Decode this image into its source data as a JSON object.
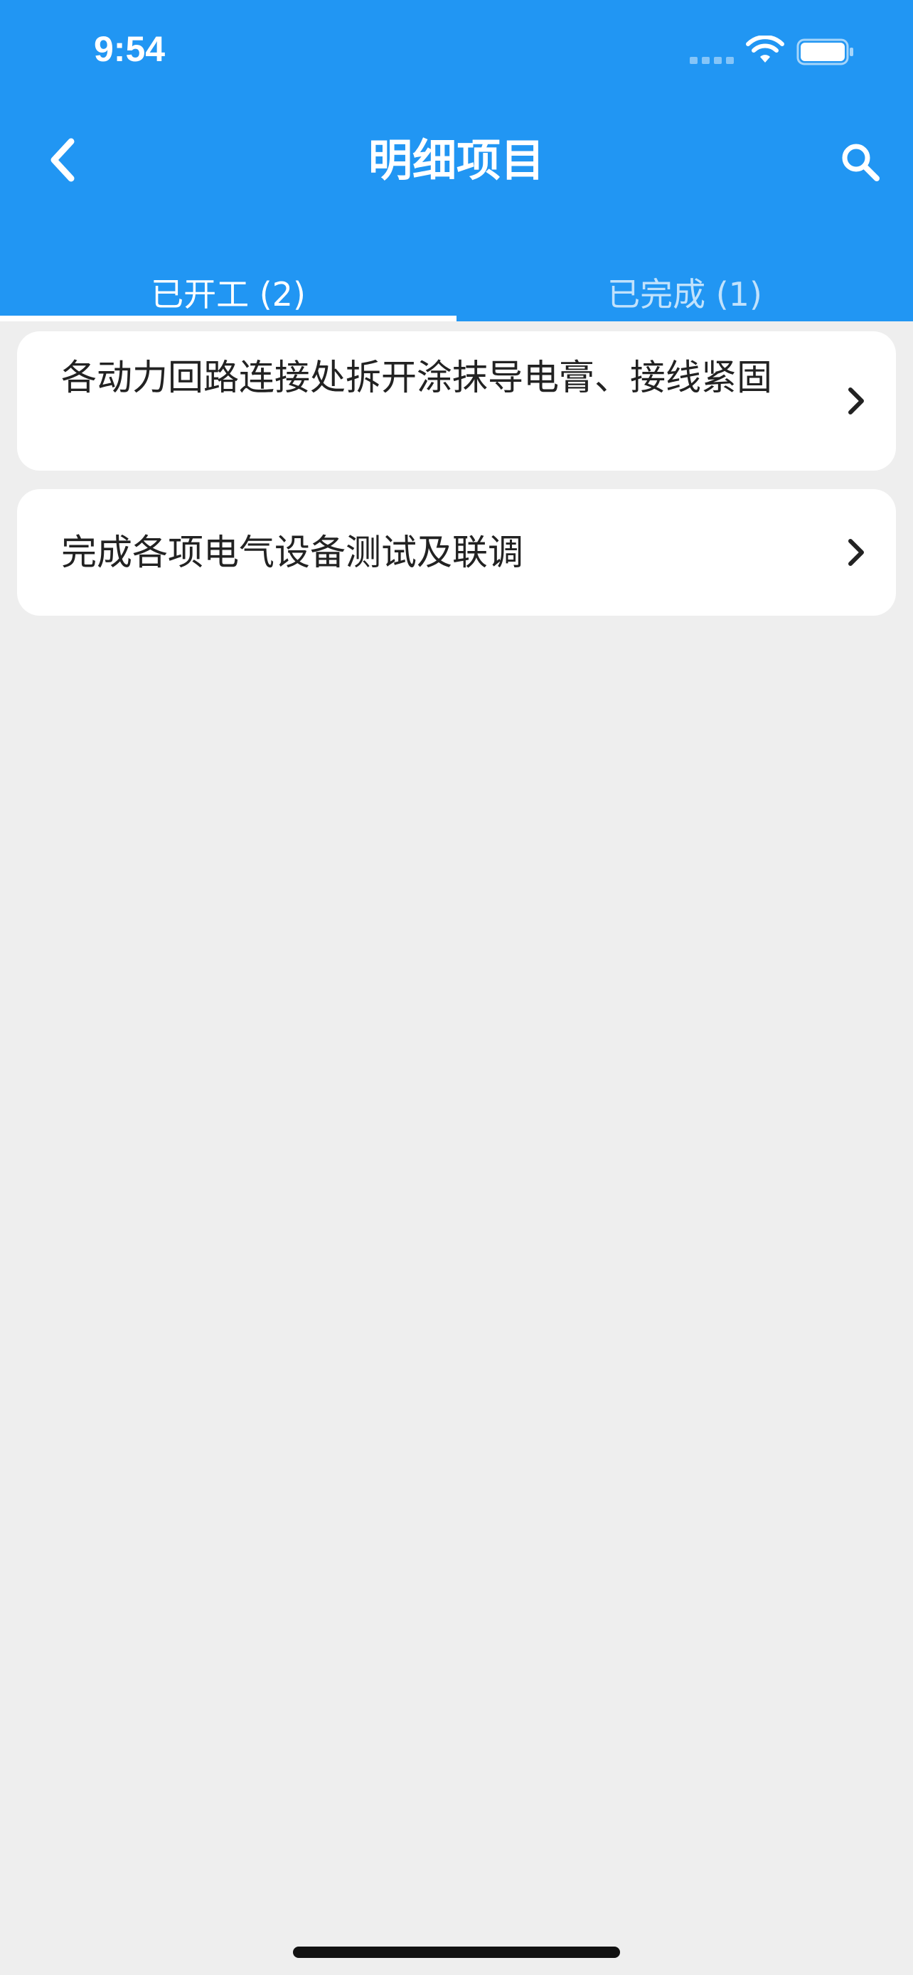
{
  "status_bar": {
    "time": "9:54"
  },
  "nav": {
    "title": "明细项目",
    "back_icon": "chevron-left-icon",
    "search_icon": "search-icon"
  },
  "tabs": [
    {
      "label": "已开工 (2)",
      "active": true
    },
    {
      "label": "已完成 (1)",
      "active": false
    }
  ],
  "items": [
    {
      "title": "各动力回路连接处拆开涂抹导电膏、接线紧固"
    },
    {
      "title": "完成各项电气设备测试及联调"
    }
  ],
  "colors": {
    "primary": "#2196f3",
    "background": "#eeeeee",
    "card": "#ffffff",
    "text": "#222222"
  }
}
